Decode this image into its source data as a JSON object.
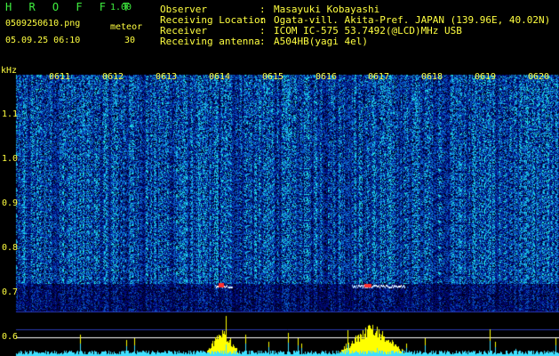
{
  "header": {
    "app_title": "H R O F F T",
    "version": "1.00",
    "filename": "0509250610.png",
    "meteor_label": "meteor",
    "timestamp": "05.09.25 06:10",
    "meteor_count": "30"
  },
  "station_info": [
    {
      "key": "Observer",
      "value": "Masayuki Kobayashi"
    },
    {
      "key": "Receiving Location",
      "value": "Ogata-vill. Akita-Pref. JAPAN (139.96E, 40.02N)"
    },
    {
      "key": "Receiver",
      "value": "ICOM IC-575 53.7492(@LCD)MHz USB"
    },
    {
      "key": "Receiving antenna",
      "value": "A504HB(yagi 4el)"
    }
  ],
  "axis": {
    "unit": "kHz",
    "y_ticks": [
      "1.1",
      "1.0",
      "0.9",
      "0.8",
      "0.7",
      "0.6"
    ],
    "time_ticks": [
      "0611",
      "0612",
      "0613",
      "0614",
      "0615",
      "0616",
      "0617",
      "0618",
      "0619",
      "0620"
    ]
  },
  "colors": {
    "text_yellow": "#ffff40",
    "title_green": "#3ff03f",
    "background": "#000000",
    "spectrum_blue": "#0a1e8c",
    "echo_red": "#ff3030",
    "histogram_yellow": "#ffff00",
    "histogram_cyan": "#40e0ff"
  }
}
